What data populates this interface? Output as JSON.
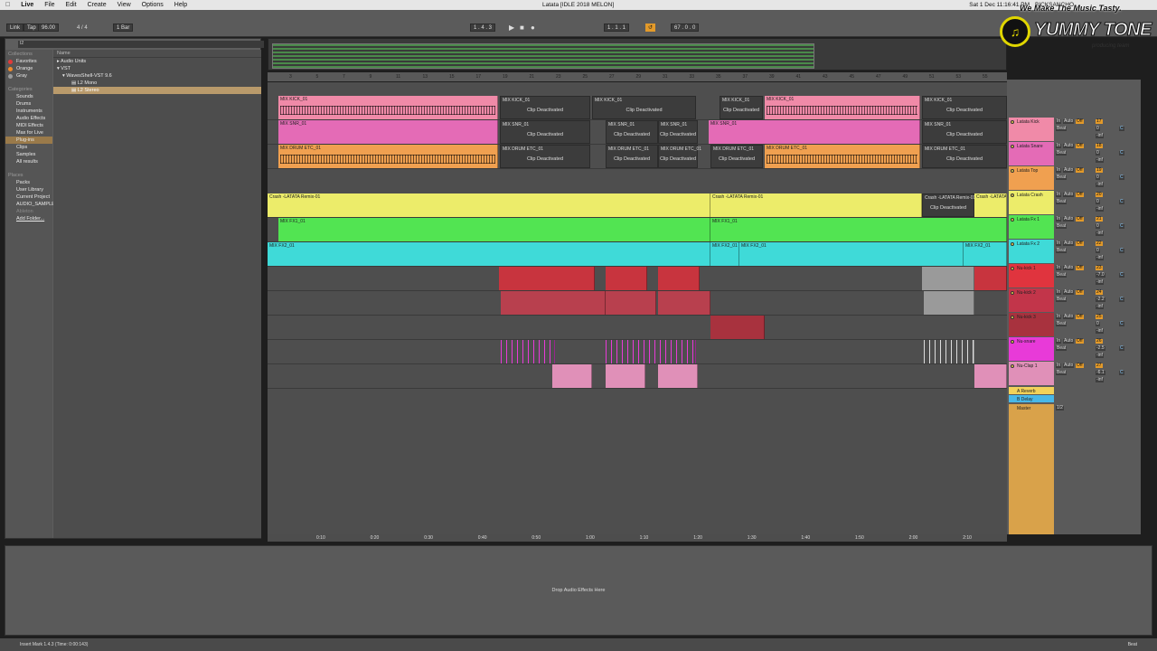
{
  "menubar": {
    "app": "Live",
    "items": [
      "File",
      "Edit",
      "Create",
      "View",
      "Options",
      "Help"
    ],
    "title": "Latata  [IDLE 2018 MELON]",
    "clock": "Sat 1 Dec  11:16:41 PM",
    "user": "BICKSANCHO"
  },
  "brand": {
    "tagline": "We Make The Music Tasty.",
    "name": "YUMMY TONE",
    "sub": "producing team"
  },
  "transport": {
    "link": "Link",
    "tap": "Tap",
    "tempo": "96.00",
    "sig1": "4",
    "sig2": "4",
    "quant": "1 Bar",
    "position": "1 .  4 .  3",
    "loop_start": "1 .  1 .  1",
    "loop_len": "67 .  0 .  0"
  },
  "browser": {
    "search": "l2",
    "name_header": "Name",
    "collections_header": "Collections",
    "collections": [
      {
        "label": "Favorites",
        "color": "#e03a3a"
      },
      {
        "label": "Orange",
        "color": "#f08a2a"
      },
      {
        "label": "Gray",
        "color": "#9a9a9a"
      }
    ],
    "categories_header": "Categories",
    "categories": [
      "Sounds",
      "Drums",
      "Instruments",
      "Audio Effects",
      "MIDI Effects",
      "Max for Live",
      "Plug-ins",
      "Clips",
      "Samples",
      "All results"
    ],
    "places_header": "Places",
    "places": [
      "Packs",
      "User Library",
      "Current Project",
      "AUDIO_SAMPLE",
      "Ableton",
      "Add Folder..."
    ],
    "tree": [
      "Audio Units",
      "VST",
      "WavesShell-VST 9.6",
      "L2 Mono",
      "L2 Stereo"
    ]
  },
  "ruler": [
    "3",
    "5",
    "7",
    "9",
    "11",
    "13",
    "15",
    "17",
    "19",
    "21",
    "23",
    "25",
    "27",
    "29",
    "31",
    "33",
    "35",
    "37",
    "39",
    "41",
    "43",
    "45",
    "47",
    "49",
    "51",
    "53",
    "55"
  ],
  "time_ticks": [
    "0:10",
    "0:20",
    "0:30",
    "0:40",
    "0:50",
    "1:00",
    "1:10",
    "1:20",
    "1:30",
    "1:40",
    "1:50",
    "2:00",
    "2:10"
  ],
  "clips": {
    "kick": "MIX KICK_01",
    "snr": "MIX SNR_01",
    "drum": "MIX DRUM ETC_01",
    "crash": "Crash -LATATA Remix-01",
    "crash2": "Crash -LATATA Remix-01",
    "fx1": "MIX FX1_01",
    "fx2": "MIX FX2_01",
    "deact": "Clip Deactivated"
  },
  "tracks": [
    {
      "name": "Latata Kick",
      "color": "#f08aa8",
      "vol": "17",
      "pan": "C",
      "volnum": "0"
    },
    {
      "name": "Latata Snare",
      "color": "#e46bb6",
      "vol": "18",
      "pan": "C",
      "volnum": "0"
    },
    {
      "name": "Latata Top",
      "color": "#f0a050",
      "vol": "19",
      "pan": "C",
      "volnum": "0"
    },
    {
      "name": "Latata Crash",
      "color": "#ecec6a",
      "vol": "20",
      "pan": "C",
      "volnum": "0"
    },
    {
      "name": "Latata Fx 1",
      "color": "#52e452",
      "vol": "21",
      "pan": "C",
      "volnum": "0"
    },
    {
      "name": "Latata Fx 2",
      "color": "#3fdad8",
      "vol": "22",
      "pan": "C",
      "volnum": "0"
    },
    {
      "name": "Nu-kick 1",
      "color": "#e0343e",
      "vol": "23",
      "pan": "C",
      "volnum": "-7.0"
    },
    {
      "name": "Nu-kick 2",
      "color": "#c2354a",
      "vol": "24",
      "pan": "C",
      "volnum": "-2.2"
    },
    {
      "name": "Nu-kick 3",
      "color": "#a8323e",
      "vol": "25",
      "pan": "C",
      "volnum": "0"
    },
    {
      "name": "Nu-snare",
      "color": "#e83ad8",
      "vol": "26",
      "pan": "C",
      "volnum": "-2.5"
    },
    {
      "name": "Nu-Clap 1",
      "color": "#e090b8",
      "vol": "27",
      "pan": "C",
      "volnum": "-6.1"
    }
  ],
  "returns": [
    {
      "name": "A Reverb",
      "color": "#f2d25a"
    },
    {
      "name": "B Delay",
      "color": "#48b8e8"
    }
  ],
  "master": {
    "name": "Master",
    "val": "1/2"
  },
  "mixer_labels": {
    "in": "In",
    "auto": "Auto",
    "off": "Off",
    "beat": "Beat",
    "inf": "-inf",
    "post": "Post"
  },
  "detail": {
    "drop": "Drop Audio Effects Here"
  },
  "status": {
    "msg": "Insert Mark 1.4.3 (Time: 0:00:143)",
    "right": "Beat"
  }
}
